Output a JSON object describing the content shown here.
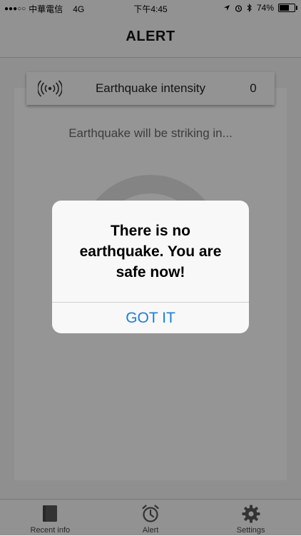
{
  "status_bar": {
    "signal_dots": "●●●○○",
    "carrier": "中華電信",
    "network": "4G",
    "time": "下午4:45",
    "battery": "74%",
    "battery_level": 0.74
  },
  "nav": {
    "title": "ALERT"
  },
  "intensity": {
    "label": "Earthquake intensity",
    "value": "0"
  },
  "main": {
    "strike_text": "Earthquake will be striking in..."
  },
  "tabs": [
    {
      "label": "Recent info",
      "icon": "book-icon"
    },
    {
      "label": "Alert",
      "icon": "alarm-clock-icon"
    },
    {
      "label": "Settings",
      "icon": "gear-icon"
    }
  ],
  "alert": {
    "message": "There is no earthquake. You are safe now!",
    "button_label": "GOT IT"
  },
  "colors": {
    "accent": "#1a7fde",
    "overlay": "#000000"
  }
}
